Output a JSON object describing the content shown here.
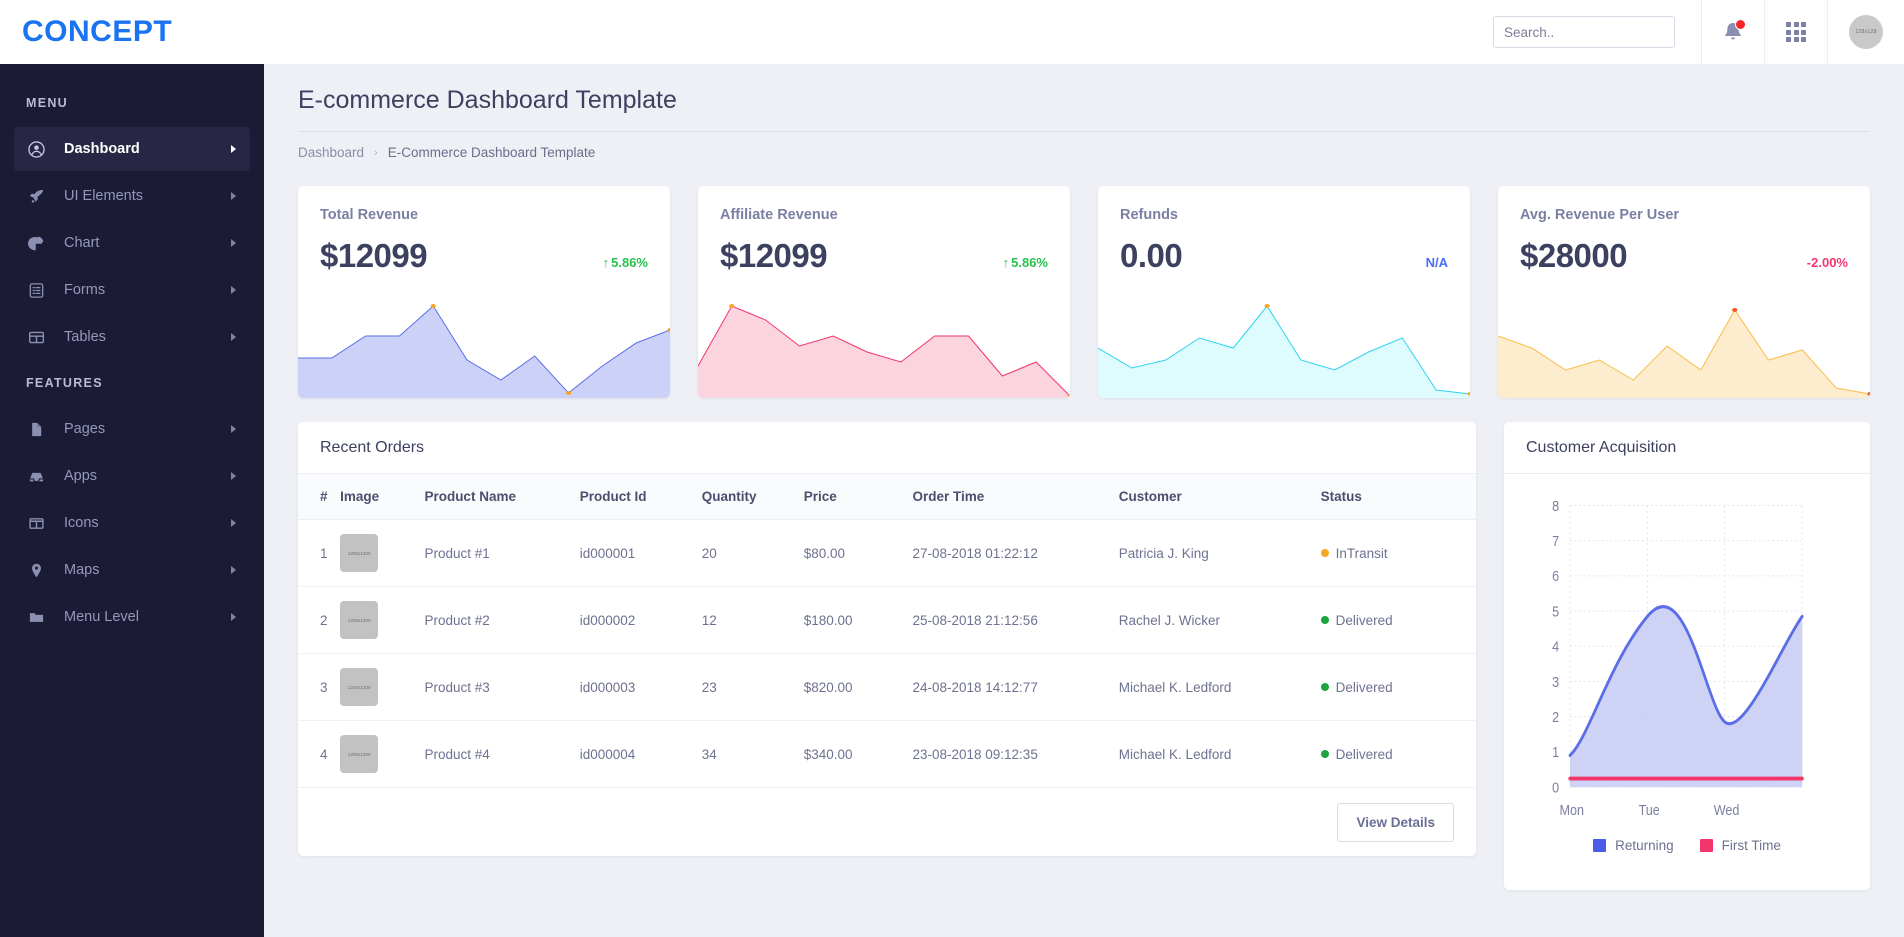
{
  "brand": {
    "name": "CONCEPT",
    "color": "#1a73f0"
  },
  "topbar": {
    "search": {
      "placeholder": "Search..",
      "value": ""
    },
    "notifications_icon": "bell-icon",
    "apps_icon": "grid-icon",
    "avatar_text": "128x128"
  },
  "sidebar": {
    "sections": [
      {
        "title": "MENU",
        "items": [
          {
            "label": "Dashboard",
            "icon": "user-circle-icon",
            "active": true
          },
          {
            "label": "UI Elements",
            "icon": "rocket-icon",
            "active": false
          },
          {
            "label": "Chart",
            "icon": "pie-chart-icon",
            "active": false
          },
          {
            "label": "Forms",
            "icon": "form-icon",
            "active": false
          },
          {
            "label": "Tables",
            "icon": "table-icon",
            "active": false
          }
        ]
      },
      {
        "title": "FEATURES",
        "items": [
          {
            "label": "Pages",
            "icon": "file-icon",
            "active": false
          },
          {
            "label": "Apps",
            "icon": "inbox-icon",
            "active": false
          },
          {
            "label": "Icons",
            "icon": "columns-icon",
            "active": false
          },
          {
            "label": "Maps",
            "icon": "map-pin-icon",
            "active": false
          },
          {
            "label": "Menu Level",
            "icon": "folder-icon",
            "active": false
          }
        ]
      }
    ]
  },
  "page": {
    "title": "E-commerce Dashboard Template",
    "breadcrumb": [
      "Dashboard",
      "E-Commerce Dashboard Template"
    ],
    "breadcrumb_separator": "›"
  },
  "stats": [
    {
      "label": "Total Revenue",
      "value": "$12099",
      "delta": "5.86%",
      "delta_dir": "up",
      "arrow": "↑",
      "line_color": "#5b6ee8",
      "fill_color": "#ccd2f7"
    },
    {
      "label": "Affiliate Revenue",
      "value": "$12099",
      "delta": "5.86%",
      "delta_dir": "up",
      "arrow": "↑",
      "line_color": "#f2356a",
      "fill_color": "#fbd4e0"
    },
    {
      "label": "Refunds",
      "value": "0.00",
      "delta": "N/A",
      "delta_dir": "na",
      "arrow": "",
      "line_color": "#2ed3f0",
      "fill_color": "#defbfd"
    },
    {
      "label": "Avg. Revenue Per User",
      "value": "$28000",
      "delta": "-2.00%",
      "delta_dir": "down",
      "arrow": "",
      "line_color": "#f9bd4a",
      "fill_color": "#fdeccd"
    }
  ],
  "orders": {
    "title": "Recent Orders",
    "columns": [
      "#",
      "Image",
      "Product Name",
      "Product Id",
      "Quantity",
      "Price",
      "Order Time",
      "Customer",
      "Status"
    ],
    "thumb_text": "1200x1200",
    "rows": [
      {
        "num": "1",
        "name": "Product #1",
        "pid": "id000001",
        "qty": "20",
        "price": "$80.00",
        "time": "27-08-2018 01:22:12",
        "customer": "Patricia J. King",
        "status": "InTransit",
        "status_color": "#f5a623"
      },
      {
        "num": "2",
        "name": "Product #2",
        "pid": "id000002",
        "qty": "12",
        "price": "$180.00",
        "time": "25-08-2018 21:12:56",
        "customer": "Rachel J. Wicker",
        "status": "Delivered",
        "status_color": "#1da33f"
      },
      {
        "num": "3",
        "name": "Product #3",
        "pid": "id000003",
        "qty": "23",
        "price": "$820.00",
        "time": "24-08-2018 14:12:77",
        "customer": "Michael K. Ledford",
        "status": "Delivered",
        "status_color": "#1da33f"
      },
      {
        "num": "4",
        "name": "Product #4",
        "pid": "id000004",
        "qty": "34",
        "price": "$340.00",
        "time": "23-08-2018 09:12:35",
        "customer": "Michael K. Ledford",
        "status": "Delivered",
        "status_color": "#1da33f"
      }
    ],
    "view_details_label": "View Details"
  },
  "acquisition": {
    "title": "Customer Acquisition"
  },
  "chart_data": [
    {
      "type": "area",
      "title": "Total Revenue",
      "x": [
        0,
        1,
        2,
        3,
        4,
        5,
        6,
        7,
        8,
        9,
        10,
        11
      ],
      "values": [
        40,
        40,
        62,
        62,
        92,
        38,
        18,
        42,
        5,
        32,
        55,
        68
      ],
      "ylim": [
        0,
        100
      ],
      "grid": false,
      "line_color": "#5b6ee8",
      "fill_color": "#ccd2f7",
      "marker_color": "#f5a623",
      "markers_at": [
        4,
        8,
        11
      ]
    },
    {
      "type": "area",
      "title": "Affiliate Revenue",
      "x": [
        0,
        1,
        2,
        3,
        4,
        5,
        6,
        7,
        8,
        9,
        10,
        11
      ],
      "values": [
        32,
        92,
        78,
        52,
        62,
        46,
        36,
        62,
        62,
        22,
        36,
        2
      ],
      "ylim": [
        0,
        100
      ],
      "grid": false,
      "line_color": "#f2356a",
      "fill_color": "#fbd4e0",
      "marker_color": "#f5a623",
      "markers_at": [
        1,
        11
      ]
    },
    {
      "type": "area",
      "title": "Refunds",
      "x": [
        0,
        1,
        2,
        3,
        4,
        5,
        6,
        7,
        8,
        9,
        10,
        11
      ],
      "values": [
        50,
        30,
        38,
        58,
        48,
        92,
        38,
        28,
        46,
        58,
        8,
        4
      ],
      "ylim": [
        0,
        100
      ],
      "grid": false,
      "line_color": "#2ed3f0",
      "fill_color": "#defbfd",
      "marker_color": "#f5a623",
      "markers_at": [
        5,
        11
      ]
    },
    {
      "type": "area",
      "title": "Avg. Revenue Per User",
      "x": [
        0,
        1,
        2,
        3,
        4,
        5,
        6,
        7,
        8,
        9,
        10,
        11
      ],
      "values": [
        62,
        50,
        28,
        38,
        18,
        52,
        28,
        88,
        38,
        48,
        6,
        2
      ],
      "ylim": [
        0,
        100
      ],
      "grid": false,
      "line_color": "#f9bd4a",
      "fill_color": "#fdeccd",
      "marker_color": "#f5571c",
      "markers_at": [
        7,
        11
      ]
    },
    {
      "type": "area",
      "title": "Customer Acquisition",
      "categories": [
        "Mon",
        "Tue",
        "Wed"
      ],
      "xtick_labels": [
        "Mon",
        "Tue",
        "Wed"
      ],
      "ytick_labels": [
        "0",
        "1",
        "2",
        "3",
        "4",
        "5",
        "6",
        "7",
        "8"
      ],
      "ylim": [
        0,
        8
      ],
      "grid": true,
      "legend_position": "bottom",
      "series": [
        {
          "name": "Returning",
          "color": "#5b6ee8",
          "values": [
            0.9,
            4.85,
            1.85,
            4.85
          ]
        },
        {
          "name": "First Time",
          "color": "#f2356a",
          "values": [
            0.25,
            0.25,
            0.25,
            0.25
          ]
        }
      ]
    }
  ]
}
